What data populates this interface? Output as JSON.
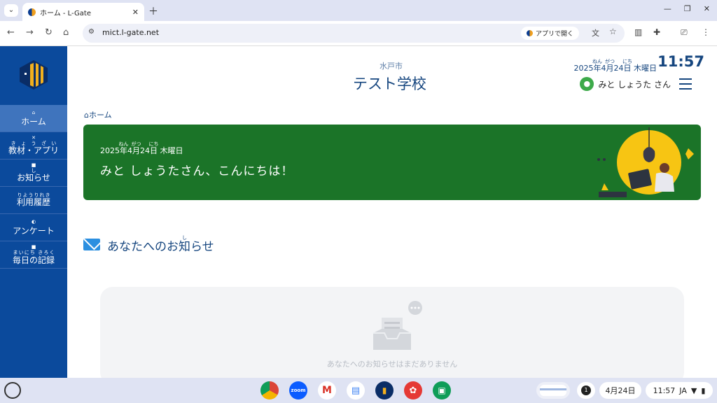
{
  "browser": {
    "tab_title": "ホーム - L-Gate",
    "url": "mict.l-gate.net",
    "open_app_label": "アプリで開く"
  },
  "sidebar": {
    "items": [
      {
        "label": "ホーム",
        "icon": "home-icon",
        "active": true
      },
      {
        "label": "教材・アプリ",
        "ruby": "きょうざい",
        "icon": "close-icon"
      },
      {
        "label": "お知らせ",
        "ruby": "し",
        "icon": "square-icon"
      },
      {
        "label": "利用履歴",
        "ruby": "りようりれき",
        "icon": "square-icon"
      },
      {
        "label": "アンケート",
        "icon": "pie-icon"
      },
      {
        "label": "毎日の記録",
        "ruby": "まいにち きろく",
        "icon": "square-icon"
      }
    ]
  },
  "header": {
    "city": "水戸市",
    "school": "テスト学校",
    "date_year": "2025",
    "date_year_unit": "年",
    "date_month": "4",
    "date_month_unit": "月",
    "date_day": "24",
    "date_day_unit": "日",
    "ruby_nen": "ねん",
    "ruby_gatsu": "がつ",
    "ruby_nichi": "にち",
    "weekday": "木曜日",
    "time": "11:57",
    "user_name": "みと しょうた さん"
  },
  "breadcrumb": "ホーム",
  "banner": {
    "weekday": "木曜日",
    "greeting": "みと しょうたさん、こんにちは！"
  },
  "notices": {
    "title_pre": "あなたへのお",
    "title_kanji": "知",
    "title_ruby": "し",
    "title_post": "らせ",
    "empty_message": "あなたへのお知らせはまだありません"
  },
  "shelf": {
    "date": "4月24日",
    "time": "11:57",
    "ime": "JA",
    "notification_count": "1",
    "apps": [
      "chrome",
      "zoom",
      "gmail",
      "docs",
      "l-gate",
      "palette",
      "classroom"
    ],
    "zoom_label": "zoom"
  },
  "colors": {
    "sidebar": "#0b4a9c",
    "banner": "#1b7428",
    "accent": "#16467f"
  }
}
